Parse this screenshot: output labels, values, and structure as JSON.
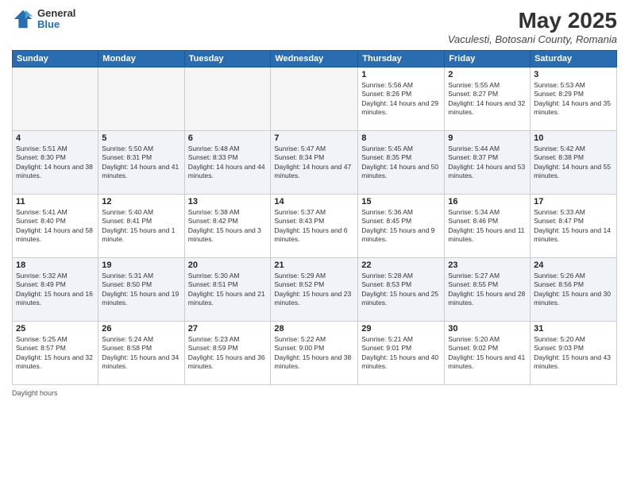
{
  "logo": {
    "general": "General",
    "blue": "Blue"
  },
  "title": "May 2025",
  "subtitle": "Vaculesti, Botosani County, Romania",
  "days_of_week": [
    "Sunday",
    "Monday",
    "Tuesday",
    "Wednesday",
    "Thursday",
    "Friday",
    "Saturday"
  ],
  "footer": "Daylight hours",
  "weeks": [
    [
      {
        "day": "",
        "info": ""
      },
      {
        "day": "",
        "info": ""
      },
      {
        "day": "",
        "info": ""
      },
      {
        "day": "",
        "info": ""
      },
      {
        "day": "1",
        "info": "Sunrise: 5:56 AM\nSunset: 8:26 PM\nDaylight: 14 hours and 29 minutes."
      },
      {
        "day": "2",
        "info": "Sunrise: 5:55 AM\nSunset: 8:27 PM\nDaylight: 14 hours and 32 minutes."
      },
      {
        "day": "3",
        "info": "Sunrise: 5:53 AM\nSunset: 8:29 PM\nDaylight: 14 hours and 35 minutes."
      }
    ],
    [
      {
        "day": "4",
        "info": "Sunrise: 5:51 AM\nSunset: 8:30 PM\nDaylight: 14 hours and 38 minutes."
      },
      {
        "day": "5",
        "info": "Sunrise: 5:50 AM\nSunset: 8:31 PM\nDaylight: 14 hours and 41 minutes."
      },
      {
        "day": "6",
        "info": "Sunrise: 5:48 AM\nSunset: 8:33 PM\nDaylight: 14 hours and 44 minutes."
      },
      {
        "day": "7",
        "info": "Sunrise: 5:47 AM\nSunset: 8:34 PM\nDaylight: 14 hours and 47 minutes."
      },
      {
        "day": "8",
        "info": "Sunrise: 5:45 AM\nSunset: 8:35 PM\nDaylight: 14 hours and 50 minutes."
      },
      {
        "day": "9",
        "info": "Sunrise: 5:44 AM\nSunset: 8:37 PM\nDaylight: 14 hours and 53 minutes."
      },
      {
        "day": "10",
        "info": "Sunrise: 5:42 AM\nSunset: 8:38 PM\nDaylight: 14 hours and 55 minutes."
      }
    ],
    [
      {
        "day": "11",
        "info": "Sunrise: 5:41 AM\nSunset: 8:40 PM\nDaylight: 14 hours and 58 minutes."
      },
      {
        "day": "12",
        "info": "Sunrise: 5:40 AM\nSunset: 8:41 PM\nDaylight: 15 hours and 1 minute."
      },
      {
        "day": "13",
        "info": "Sunrise: 5:38 AM\nSunset: 8:42 PM\nDaylight: 15 hours and 3 minutes."
      },
      {
        "day": "14",
        "info": "Sunrise: 5:37 AM\nSunset: 8:43 PM\nDaylight: 15 hours and 6 minutes."
      },
      {
        "day": "15",
        "info": "Sunrise: 5:36 AM\nSunset: 8:45 PM\nDaylight: 15 hours and 9 minutes."
      },
      {
        "day": "16",
        "info": "Sunrise: 5:34 AM\nSunset: 8:46 PM\nDaylight: 15 hours and 11 minutes."
      },
      {
        "day": "17",
        "info": "Sunrise: 5:33 AM\nSunset: 8:47 PM\nDaylight: 15 hours and 14 minutes."
      }
    ],
    [
      {
        "day": "18",
        "info": "Sunrise: 5:32 AM\nSunset: 8:49 PM\nDaylight: 15 hours and 16 minutes."
      },
      {
        "day": "19",
        "info": "Sunrise: 5:31 AM\nSunset: 8:50 PM\nDaylight: 15 hours and 19 minutes."
      },
      {
        "day": "20",
        "info": "Sunrise: 5:30 AM\nSunset: 8:51 PM\nDaylight: 15 hours and 21 minutes."
      },
      {
        "day": "21",
        "info": "Sunrise: 5:29 AM\nSunset: 8:52 PM\nDaylight: 15 hours and 23 minutes."
      },
      {
        "day": "22",
        "info": "Sunrise: 5:28 AM\nSunset: 8:53 PM\nDaylight: 15 hours and 25 minutes."
      },
      {
        "day": "23",
        "info": "Sunrise: 5:27 AM\nSunset: 8:55 PM\nDaylight: 15 hours and 28 minutes."
      },
      {
        "day": "24",
        "info": "Sunrise: 5:26 AM\nSunset: 8:56 PM\nDaylight: 15 hours and 30 minutes."
      }
    ],
    [
      {
        "day": "25",
        "info": "Sunrise: 5:25 AM\nSunset: 8:57 PM\nDaylight: 15 hours and 32 minutes."
      },
      {
        "day": "26",
        "info": "Sunrise: 5:24 AM\nSunset: 8:58 PM\nDaylight: 15 hours and 34 minutes."
      },
      {
        "day": "27",
        "info": "Sunrise: 5:23 AM\nSunset: 8:59 PM\nDaylight: 15 hours and 36 minutes."
      },
      {
        "day": "28",
        "info": "Sunrise: 5:22 AM\nSunset: 9:00 PM\nDaylight: 15 hours and 38 minutes."
      },
      {
        "day": "29",
        "info": "Sunrise: 5:21 AM\nSunset: 9:01 PM\nDaylight: 15 hours and 40 minutes."
      },
      {
        "day": "30",
        "info": "Sunrise: 5:20 AM\nSunset: 9:02 PM\nDaylight: 15 hours and 41 minutes."
      },
      {
        "day": "31",
        "info": "Sunrise: 5:20 AM\nSunset: 9:03 PM\nDaylight: 15 hours and 43 minutes."
      }
    ]
  ]
}
